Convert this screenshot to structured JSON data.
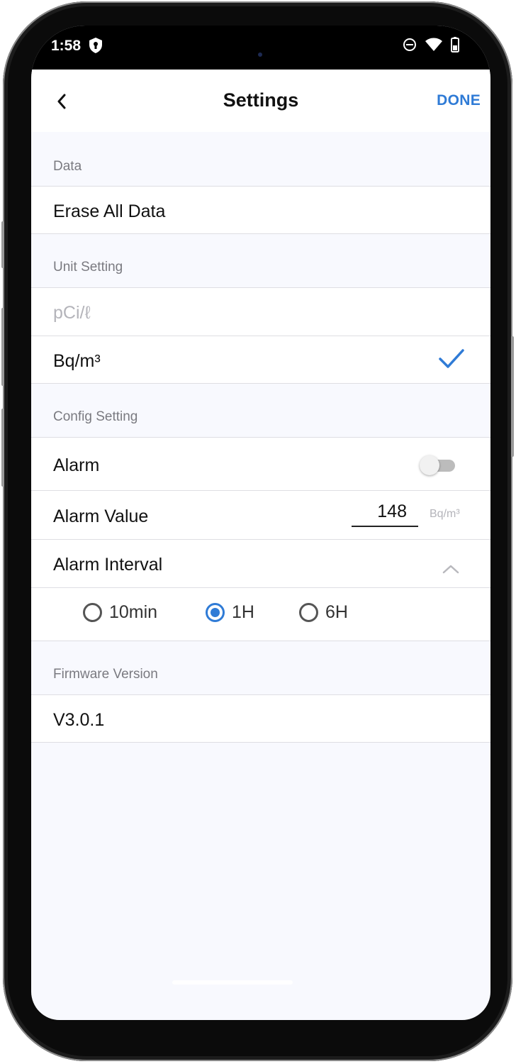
{
  "status_bar": {
    "time": "1:58"
  },
  "nav": {
    "title": "Settings",
    "done_label": "DONE"
  },
  "sections": {
    "data": {
      "header": "Data",
      "erase_label": "Erase All Data"
    },
    "unit": {
      "header": "Unit Setting",
      "options": [
        "pCi/ℓ",
        "Bq/m³"
      ],
      "selected": "Bq/m³"
    },
    "config": {
      "header": "Config Setting",
      "alarm_label": "Alarm",
      "alarm_on": false,
      "alarm_value_label": "Alarm Value",
      "alarm_value": "148",
      "alarm_unit": "Bq/m³",
      "alarm_interval_label": "Alarm Interval",
      "interval_options": [
        "10min",
        "1H",
        "6H"
      ],
      "interval_selected": "1H"
    },
    "firmware": {
      "header": "Firmware Version",
      "version": "V3.0.1"
    }
  },
  "colors": {
    "accent": "#2f7bd6",
    "section_bg": "#f8f9fe",
    "divider": "#dedee3"
  },
  "icons": [
    "back-chevron-icon",
    "check-icon",
    "chevron-up-icon",
    "shield-icon",
    "dnd-icon",
    "wifi-icon",
    "battery-icon"
  ]
}
